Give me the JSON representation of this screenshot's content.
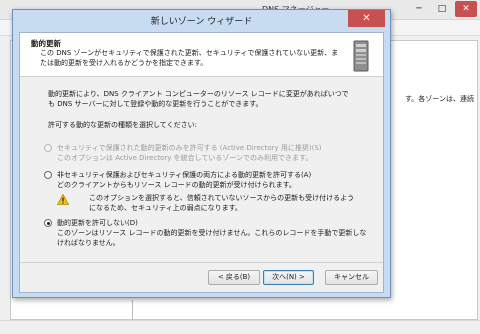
{
  "background_window": {
    "title": "DNS マネージャー",
    "fragment_text": "す。各ゾーンは、連続"
  },
  "window_controls": {
    "minimize": "─",
    "maximize": "□",
    "close": "✕"
  },
  "dialog": {
    "title": "新しいゾーン ウィザード",
    "close_glyph": "✕",
    "header": {
      "title": "動的更新",
      "description": "この DNS ゾーンがセキュリティで保護された更新、セキュリティで保護されていない更新、または動的更新を受け入れるかどうかを指定できます。",
      "icon": "server-icon"
    },
    "intro": "動的更新により、DNS クライアント コンピューターのリソース レコードに変更があればいつでも DNS サーバーに対して登録や動的な更新を行うことができます。",
    "prompt": "許可する動的な更新の種類を選択してください:",
    "options": [
      {
        "label": "セキュリティで保護された動的更新のみを許可する (Active Directory 用に推奨)(S)",
        "description": "このオプションは Active Directory を統合しているゾーンでのみ利用できます。",
        "enabled": false,
        "selected": false
      },
      {
        "label": "非セキュリティ保護およびセキュリティ保護の両方による動的更新を許可する(A)",
        "description": "どのクライアントからもリソース レコードの動的更新が受け付けられます。",
        "warning": "このオプションを選択すると、信頼されていないソースからの更新も受け付けるようになるため、セキュリティ上の弱点になります。",
        "warning_icon": "warning-icon",
        "enabled": true,
        "selected": false
      },
      {
        "label": "動的更新を許可しない(D)",
        "description": "このゾーンはリソース レコードの動的更新を受け付けません。これらのレコードを手動で更新しなければなりません。",
        "enabled": true,
        "selected": true
      }
    ],
    "buttons": {
      "back": "< 戻る(B)",
      "next": "次へ(N) >",
      "cancel": "キャンセル"
    }
  },
  "colors": {
    "dialog_frame": "#c7dcf1",
    "close_button": "#c75050",
    "default_button_border": "#3c7fb1"
  }
}
